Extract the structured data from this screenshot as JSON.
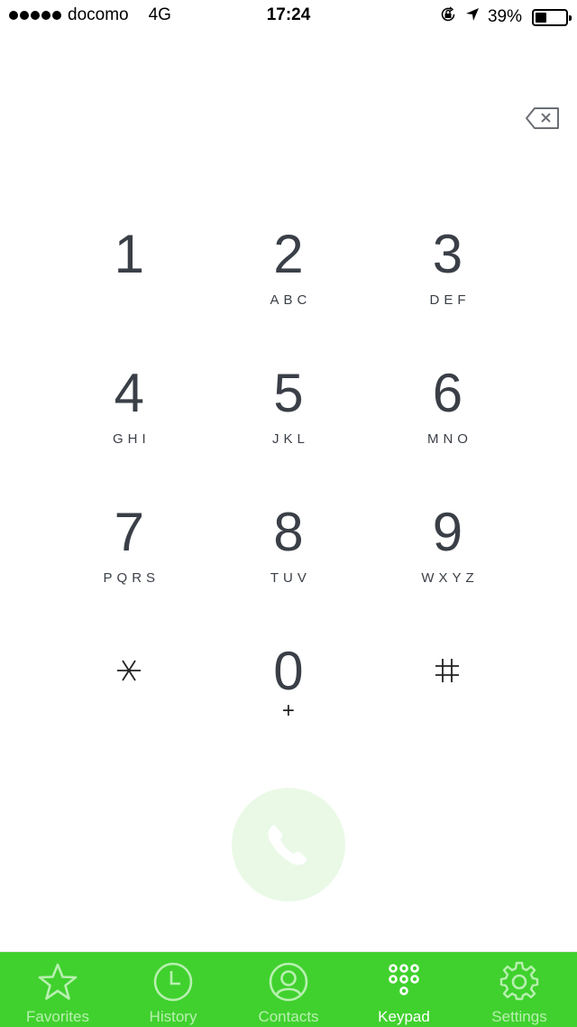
{
  "status_bar": {
    "signal_bars": 5,
    "carrier": "docomo",
    "network": "4G",
    "time": "17:24",
    "battery_percent": "39%",
    "battery_level": 0.39,
    "icons": [
      "orientation-lock-icon",
      "location-arrow-icon",
      "battery-icon"
    ]
  },
  "dialer": {
    "number_display": "",
    "delete_icon": "backspace-icon"
  },
  "keypad": {
    "keys": [
      {
        "digit": "1",
        "letters": ""
      },
      {
        "digit": "2",
        "letters": "ABC"
      },
      {
        "digit": "3",
        "letters": "DEF"
      },
      {
        "digit": "4",
        "letters": "GHI"
      },
      {
        "digit": "5",
        "letters": "JKL"
      },
      {
        "digit": "6",
        "letters": "MNO"
      },
      {
        "digit": "7",
        "letters": "PQRS"
      },
      {
        "digit": "8",
        "letters": "TUV"
      },
      {
        "digit": "9",
        "letters": "WXYZ"
      },
      {
        "digit": "*",
        "letters": ""
      },
      {
        "digit": "0",
        "letters": "+"
      },
      {
        "digit": "#",
        "letters": ""
      }
    ]
  },
  "call_button": {
    "icon": "phone-icon",
    "color": "#e9f9e6"
  },
  "tab_bar": {
    "background": "#40d12e",
    "active_index": 3,
    "tabs": [
      {
        "label": "Favorites",
        "icon": "star-icon"
      },
      {
        "label": "History",
        "icon": "clock-icon"
      },
      {
        "label": "Contacts",
        "icon": "person-icon"
      },
      {
        "label": "Keypad",
        "icon": "keypad-icon"
      },
      {
        "label": "Settings",
        "icon": "gear-icon"
      }
    ]
  }
}
